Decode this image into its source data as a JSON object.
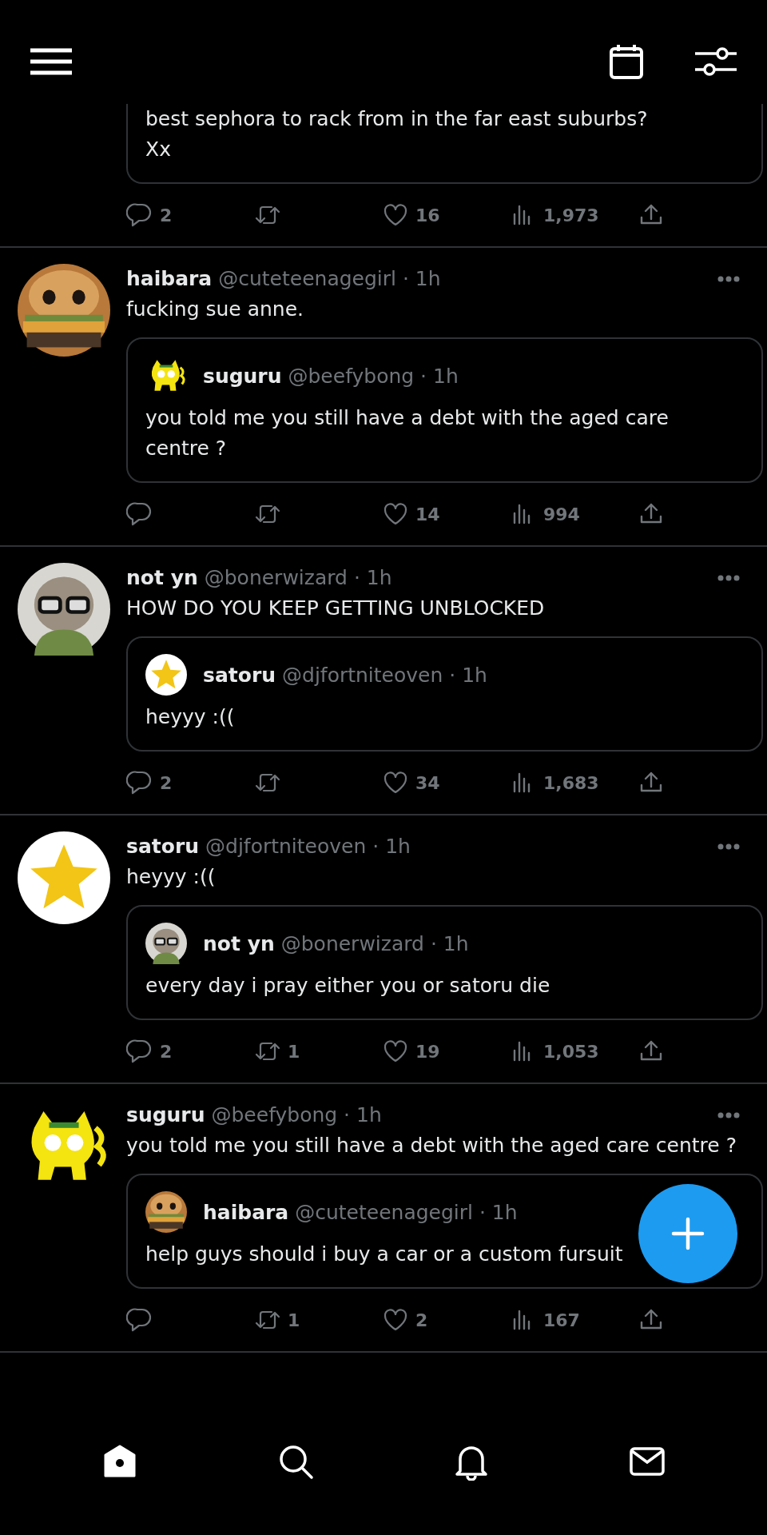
{
  "feed": [
    {
      "kind": "fragment",
      "quote": {
        "text": "best sephora to rack from in the far east suburbs? Xx"
      },
      "actions": [
        {
          "kind": "reply",
          "count": "2"
        },
        {
          "kind": "retweet"
        },
        {
          "kind": "like",
          "count": "16"
        },
        {
          "kind": "views",
          "count": "1,973"
        },
        {
          "kind": "share"
        }
      ]
    },
    {
      "kind": "tweet",
      "name": "haibara",
      "meta": "@cuteteenagegirl · 1h",
      "text": "fucking sue anne.",
      "quote": {
        "name": "suguru",
        "meta": "@beefybong · 1h",
        "text": "you told me you still have a debt with the aged care centre ?"
      },
      "actions": [
        {
          "kind": "reply"
        },
        {
          "kind": "retweet"
        },
        {
          "kind": "like",
          "count": "14"
        },
        {
          "kind": "views",
          "count": "994"
        },
        {
          "kind": "share"
        }
      ]
    },
    {
      "kind": "tweet",
      "name": "not yn",
      "meta": "@bonerwizard · 1h",
      "text": "HOW DO YOU KEEP GETTING UNBLOCKED",
      "quote": {
        "name": "satoru",
        "meta": "@djfortniteoven · 1h",
        "text": "heyyy :(("
      },
      "actions": [
        {
          "kind": "reply",
          "count": "2"
        },
        {
          "kind": "retweet"
        },
        {
          "kind": "like",
          "count": "34"
        },
        {
          "kind": "views",
          "count": "1,683"
        },
        {
          "kind": "share"
        }
      ]
    },
    {
      "kind": "tweet",
      "name": "satoru",
      "meta": "@djfortniteoven · 1h",
      "text": "heyyy :((",
      "quote": {
        "name": "not yn",
        "meta": "@bonerwizard · 1h",
        "text": "every day i pray either you or satoru die"
      },
      "actions": [
        {
          "kind": "reply",
          "count": "2"
        },
        {
          "kind": "retweet",
          "count": "1"
        },
        {
          "kind": "like",
          "count": "19"
        },
        {
          "kind": "views",
          "count": "1,053"
        },
        {
          "kind": "share"
        }
      ]
    },
    {
      "kind": "tweet",
      "name": "suguru",
      "meta": "@beefybong · 1h",
      "text": "you told me you still have a debt with the aged care centre ?",
      "quote": {
        "name": "haibara",
        "meta": "@cuteteenagegirl · 1h",
        "text": "help guys should i buy a car or a custom fursuit"
      },
      "actions": [
        {
          "kind": "reply"
        },
        {
          "kind": "retweet",
          "count": "1"
        },
        {
          "kind": "like",
          "count": "2"
        },
        {
          "kind": "views",
          "count": "167"
        },
        {
          "kind": "share"
        }
      ]
    }
  ],
  "nav": [
    {
      "kind": "home",
      "selected": true
    },
    {
      "kind": "search",
      "selected": false
    },
    {
      "kind": "notifications",
      "selected": false
    },
    {
      "kind": "messages",
      "selected": false
    }
  ]
}
